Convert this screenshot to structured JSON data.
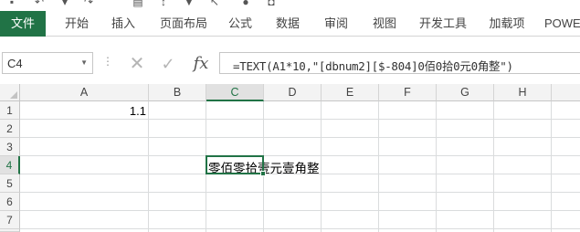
{
  "ribbon": {
    "tabs": [
      {
        "label": "文件"
      },
      {
        "label": "开始"
      },
      {
        "label": "插入"
      },
      {
        "label": "页面布局"
      },
      {
        "label": "公式"
      },
      {
        "label": "数据"
      },
      {
        "label": "审阅"
      },
      {
        "label": "视图"
      },
      {
        "label": "开发工具"
      },
      {
        "label": "加载项"
      },
      {
        "label": "POWE"
      }
    ],
    "active_color": "#217346"
  },
  "formula_bar": {
    "name_box": "C4",
    "formula": "=TEXT(A1*10,\"[dbnum2][$-804]0佰0拾0元0角整\")",
    "fx_label": "fx"
  },
  "grid": {
    "columns": [
      "A",
      "B",
      "C",
      "D",
      "E",
      "F",
      "G",
      "H"
    ],
    "rows": [
      "1",
      "2",
      "3",
      "4",
      "5",
      "6",
      "7"
    ],
    "active_column": "C",
    "active_row": "4",
    "cells": {
      "A1": "1.1",
      "C4": "零佰零拾壹元壹角整"
    }
  }
}
